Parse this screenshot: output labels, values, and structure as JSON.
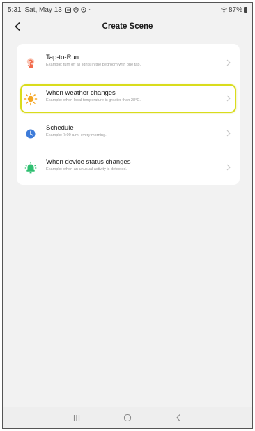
{
  "status_bar": {
    "time": "5:31",
    "date": "Sat, May 13",
    "battery": "87%",
    "icons": [
      "calendar-icon",
      "sync-icon",
      "settings-icon",
      "dot-icon",
      "wifi-icon",
      "battery-icon"
    ]
  },
  "header": {
    "title": "Create Scene",
    "back_icon": "chevron-left-icon"
  },
  "options": [
    {
      "title": "Tap-to-Run",
      "subtitle": "Example: turn off all lights in the bedroom with one tap.",
      "icon": "tap-hand-icon",
      "icon_color": "#f26a4b"
    },
    {
      "title": "When weather changes",
      "subtitle": "Example: when local temperature is greater than 28°C.",
      "icon": "sun-icon",
      "icon_color": "#f5a623",
      "highlighted": true
    },
    {
      "title": "Schedule",
      "subtitle": "Example: 7:00 a.m. every morning.",
      "icon": "clock-icon",
      "icon_color": "#3d7bd9"
    },
    {
      "title": "When device status changes",
      "subtitle": "Example: when an unusual activity is detected.",
      "icon": "device-status-icon",
      "icon_color": "#2fbf71"
    }
  ],
  "highlight_color": "#d9dc1c",
  "nav_bar": {
    "buttons": [
      "recent-apps-icon",
      "home-icon",
      "back-icon"
    ]
  }
}
